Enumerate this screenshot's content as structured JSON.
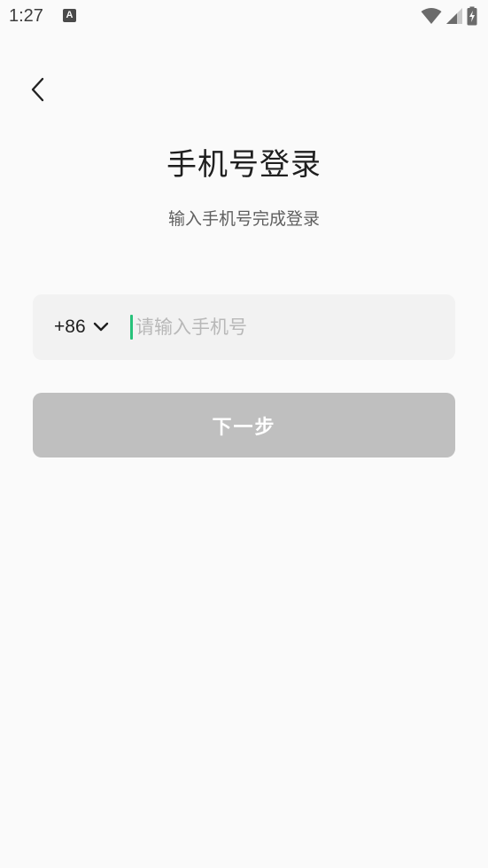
{
  "status_bar": {
    "time": "1:27",
    "notification_icon_letter": "A",
    "icons": [
      "wifi-icon",
      "cell-signal-icon",
      "battery-charging-icon"
    ]
  },
  "nav": {
    "back_icon": "chevron-left-icon"
  },
  "header": {
    "title": "手机号登录",
    "subtitle": "输入手机号完成登录"
  },
  "phone_field": {
    "country_code": "+86",
    "dropdown_icon": "chevron-down-icon",
    "placeholder": "请输入手机号",
    "value": ""
  },
  "actions": {
    "next_label": "下一步",
    "next_enabled": false
  },
  "colors": {
    "background": "#fafafa",
    "input_background": "#f2f2f2",
    "caret_accent": "#27c27a",
    "disabled_button": "#bfbfbf",
    "title_text": "#1f1f1f",
    "subtitle_text": "#5f5f5f",
    "placeholder_text": "#b8b8b8"
  }
}
